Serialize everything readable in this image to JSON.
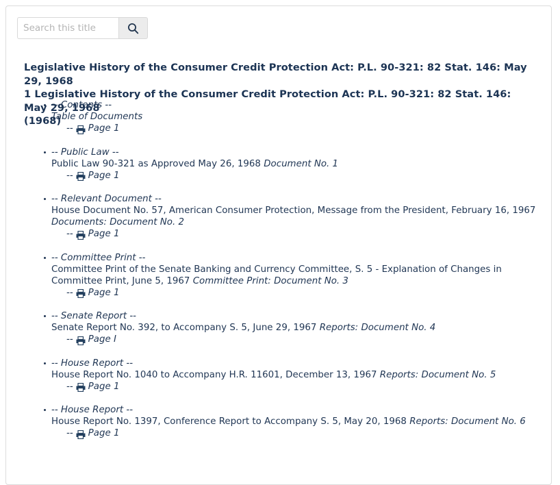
{
  "search": {
    "placeholder": "Search this title",
    "value": "",
    "icon": "search-icon",
    "button_label": ""
  },
  "title": {
    "line1": "Legislative History of the Consumer Credit Protection Act: P.L. 90-321: 82 Stat. 146: May 29, 1968",
    "line2": "1 Legislative History of the Consumer Credit Protection Act: P.L. 90-321: 82 Stat. 146: May 29, 1968",
    "line3": "(1968)"
  },
  "documents": [
    {
      "heading": "-- Contents --",
      "description": "Table of Documents",
      "description_italic": true,
      "suffix": "",
      "page_dashes": "--",
      "page_label": "Page 1",
      "icon": "printer-icon"
    },
    {
      "heading": "-- Public Law --",
      "description": "Public Law 90-321 as Approved May 26, 1968 ",
      "description_italic": false,
      "suffix": "Document No. 1",
      "page_dashes": "--",
      "page_label": "Page 1",
      "icon": "printer-icon"
    },
    {
      "heading": "-- Relevant Document --",
      "description": "House Document No. 57, American Consumer Protection, Message from the President, February 16, 1967 ",
      "description_italic": false,
      "suffix": "Documents: Document No. 2",
      "page_dashes": "--",
      "page_label": "Page 1",
      "icon": "printer-icon"
    },
    {
      "heading": "-- Committee Print --",
      "description": "Committee Print of the Senate Banking and Currency Committee, S. 5 - Explanation of Changes in Committee Print, June 5, 1967 ",
      "description_italic": false,
      "suffix": "Committee Print: Document No. 3",
      "page_dashes": "--",
      "page_label": "Page 1",
      "icon": "printer-icon"
    },
    {
      "heading": "-- Senate Report --",
      "description": "Senate Report No. 392, to Accompany S. 5, June 29, 1967 ",
      "description_italic": false,
      "suffix": "Reports: Document No. 4",
      "page_dashes": "--",
      "page_label": "Page I",
      "icon": "printer-icon"
    },
    {
      "heading": "-- House Report --",
      "description": "House Report No. 1040 to Accompany H.R. 11601, December 13, 1967 ",
      "description_italic": false,
      "suffix": "Reports: Document No. 5",
      "page_dashes": "--",
      "page_label": "Page 1",
      "icon": "printer-icon"
    },
    {
      "heading": "-- House Report --",
      "description": "House Report No. 1397, Conference Report to Accompany S. 5, May 20, 1968 ",
      "description_italic": false,
      "suffix": "Reports: Document No. 6",
      "page_dashes": "--",
      "page_label": "Page 1",
      "icon": "printer-icon"
    }
  ],
  "colors": {
    "text": "#1f3553",
    "panel_border": "#dcdcdc",
    "button_bg": "#ececec",
    "placeholder": "#b5b5b5"
  }
}
